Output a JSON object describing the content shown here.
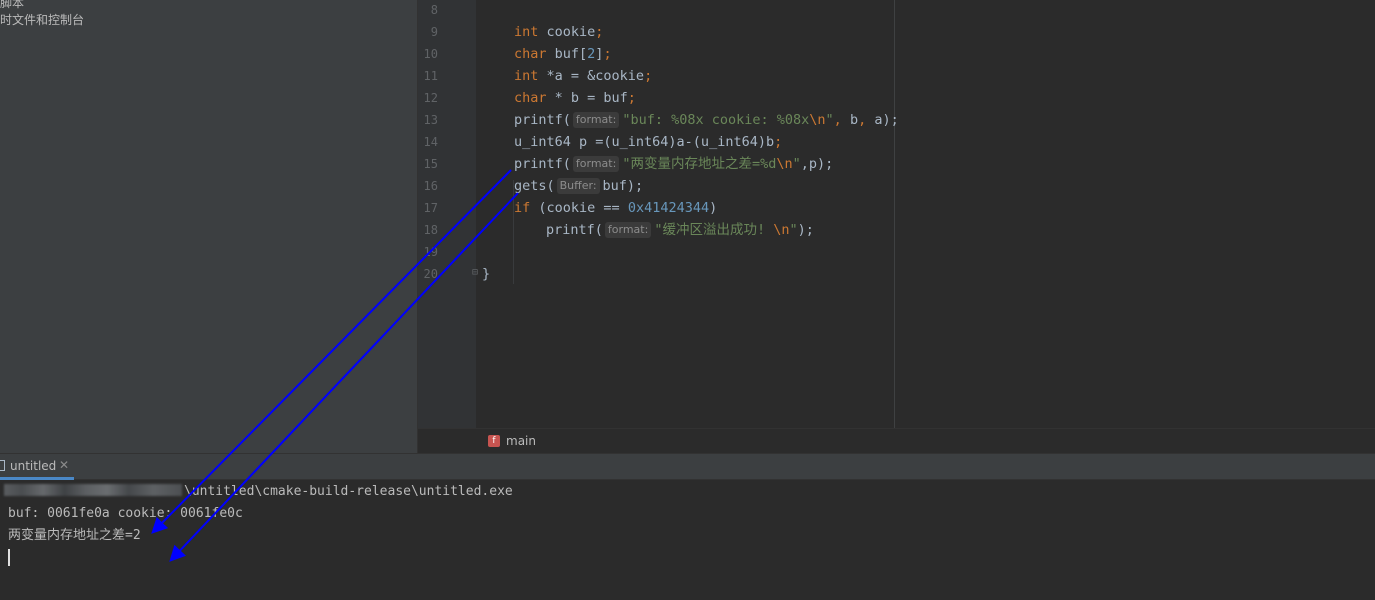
{
  "project_panel": {
    "items": [
      {
        "label": "脚本"
      },
      {
        "label": "时文件和控制台"
      }
    ]
  },
  "editor": {
    "line_numbers": [
      "8",
      "9",
      "10",
      "11",
      "12",
      "13",
      "14",
      "15",
      "16",
      "17",
      "18",
      "19",
      "20"
    ],
    "code": {
      "l9_kw": "int",
      "l9_rest": " cookie",
      "l10_kw": "char",
      "l10_rest": " buf[",
      "l10_num": "2",
      "l10_end": "]",
      "l11_kw": "int",
      "l11_rest": " *a = &cookie",
      "l12_kw": "char",
      "l12_rest": " * b = buf",
      "l13_fn": "printf(",
      "l13_hint": "format:",
      "l13_str": "\"buf: %08x cookie: %08x",
      "l13_esc": "\\n",
      "l13_q": "\"",
      "l13_rest": " b",
      "l13_rest2": " a);",
      "l14_text": "u_int64 p =(u_int64)a-(u_int64)b",
      "l15_fn": "printf(",
      "l15_hint": "format:",
      "l15_str": "\"两变量内存地址之差=%d",
      "l15_esc": "\\n",
      "l15_q": "\"",
      "l15_rest": ",p);",
      "l16_fn": "gets(",
      "l16_hint": "Buffer:",
      "l16_rest": "buf);",
      "l17_kw": "if",
      "l17_rest": " (cookie == ",
      "l17_num": "0x41424344",
      "l17_end": ")",
      "l18_fn": "printf(",
      "l18_hint": "format:",
      "l18_str": "\"缓冲区溢出成功! ",
      "l18_esc": "\\n",
      "l18_q": "\"",
      "l18_rest": ");",
      "l20_text": "}"
    },
    "semicolon": ";",
    "comma": ","
  },
  "breadcrumb": {
    "badge": "f",
    "function": "main"
  },
  "run_window": {
    "tab_label": "untitled",
    "close_glyph": "✕"
  },
  "console": {
    "path_visible": "\\untitled\\cmake-build-release\\untitled.exe",
    "output_line1": "buf: 0061fe0a cookie: 0061fe0c",
    "output_line2": "两变量内存地址之差=2"
  },
  "annotation": {
    "arrow_color": "#0000ff"
  }
}
